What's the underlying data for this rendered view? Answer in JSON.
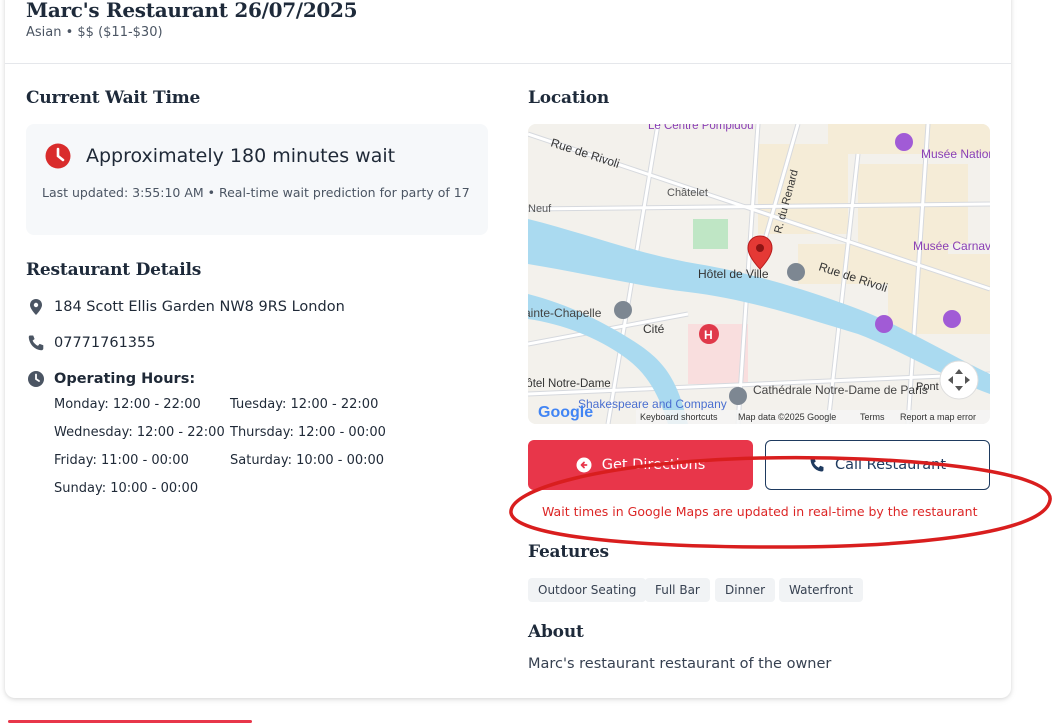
{
  "header": {
    "title": "Marc's Restaurant 26/07/2025",
    "subtitle": "Asian • $$ ($11-$30)"
  },
  "wait": {
    "heading": "Current Wait Time",
    "text": "Approximately 180 minutes wait",
    "sub": "Last updated: 3:55:10 AM • Real-time wait prediction for party of 17"
  },
  "details": {
    "heading": "Restaurant Details",
    "address": "184 Scott Ellis Garden NW8 9RS London",
    "phone": "07771761355",
    "hours_label": "Operating Hours:",
    "hours": [
      "Monday: 12:00 - 22:00",
      "Tuesday: 12:00 - 22:00",
      "Wednesday: 12:00 - 22:00",
      "Thursday: 12:00 - 00:00",
      "Friday: 11:00 - 00:00",
      "Saturday: 10:00 - 00:00",
      "Sunday: 10:00 - 00:00"
    ]
  },
  "location": {
    "heading": "Location",
    "map_labels": {
      "centre_pompidou": "Le Centre Pompidou",
      "rue_de_rivoli_1": "Rue de Rivoli",
      "chatelet": "Châtelet",
      "neuf": "Neuf",
      "renard": "R. du Renard",
      "hotel_de_ville": "Hôtel de Ville",
      "rue_de_rivoli_2": "Rue de Rivoli",
      "musee_picasso": "Musée National Picasso-Paris",
      "musee_carnavalet": "Musée Carnavalet - Histoire de Paris",
      "sainte_chapelle": "Sainte-Chapelle",
      "cite": "Cité",
      "notre_dame_station": "Hôtel Notre-Dame",
      "cathedrale": "Cathédrale Notre-Dame de Paris",
      "shakespeare": "Shakespeare and Company",
      "pont": "Pont",
      "google": "Google",
      "shortcuts": "Keyboard shortcuts",
      "map_data": "Map data ©2025 Google",
      "terms": "Terms",
      "report": "Report a map error"
    }
  },
  "actions": {
    "directions": "Get Directions",
    "call": "Call Restaurant",
    "notice": "Wait times in Google Maps are updated in real-time by the restaurant"
  },
  "features": {
    "heading": "Features",
    "tags": [
      "Outdoor Seating",
      "Full Bar",
      "Dinner",
      "Waterfront"
    ]
  },
  "about": {
    "heading": "About",
    "text": "Marc's restaurant restaurant of the owner"
  },
  "colors": {
    "accent": "#e8364a",
    "navy": "#1e3a5f",
    "annotation": "#d91e1e"
  }
}
